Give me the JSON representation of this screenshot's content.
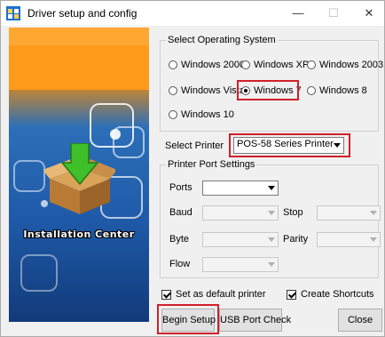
{
  "window": {
    "title": "Driver setup and config",
    "minimize": "—",
    "maximize": "☐",
    "close": "✕"
  },
  "banner": {
    "label": "Installation Center"
  },
  "os_group": {
    "legend": "Select Operating System",
    "options": [
      "Windows 2000",
      "Windows XP",
      "Windows 2003",
      "Windows Vista",
      "Windows 7",
      "Windows 8",
      "Windows 10"
    ],
    "selected": "Windows 7"
  },
  "printer": {
    "label": "Select Printer",
    "value": "POS-58 Series Printer"
  },
  "port_group": {
    "legend": "Printer Port Settings",
    "ports_label": "Ports",
    "ports_value": "",
    "baud_label": "Baud",
    "stop_label": "Stop",
    "byte_label": "Byte",
    "parity_label": "Parity",
    "flow_label": "Flow"
  },
  "options": {
    "default_printer": {
      "label": "Set as default printer",
      "checked": true
    },
    "shortcuts": {
      "label": "Create Shortcuts",
      "checked": true
    }
  },
  "buttons": {
    "begin_setup": "Begin Setup",
    "usb_port_check": "USB Port Check",
    "close": "Close"
  },
  "colors": {
    "highlight": "#d0202a",
    "banner_orange": "#ff9b1a",
    "banner_blue": "#1f5aa8"
  }
}
